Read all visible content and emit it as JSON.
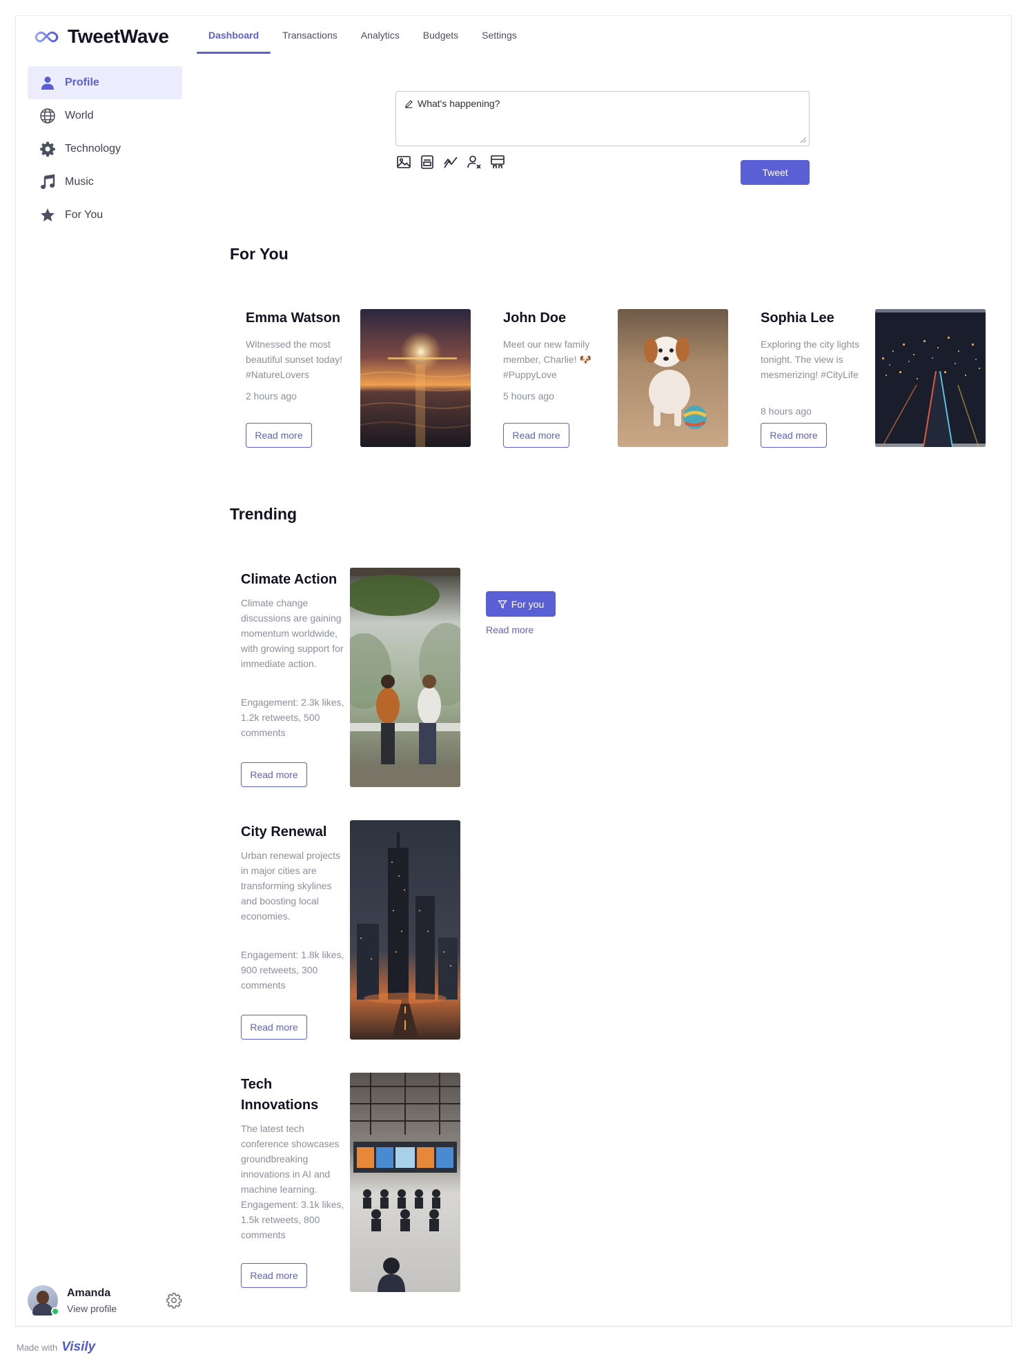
{
  "app": {
    "name": "TweetWave"
  },
  "nav": {
    "tabs": [
      {
        "label": "Dashboard",
        "active": true
      },
      {
        "label": "Transactions"
      },
      {
        "label": "Analytics"
      },
      {
        "label": "Budgets"
      },
      {
        "label": "Settings"
      }
    ]
  },
  "sidebar": {
    "items": [
      {
        "label": "Profile",
        "icon": "person-icon",
        "active": true
      },
      {
        "label": "World",
        "icon": "globe-icon"
      },
      {
        "label": "Technology",
        "icon": "gear-icon"
      },
      {
        "label": "Music",
        "icon": "music-note-icon"
      },
      {
        "label": "For You",
        "icon": "star-icon"
      }
    ]
  },
  "user": {
    "name": "Amanda",
    "link": "View profile"
  },
  "composer": {
    "placeholder": "What's happening?",
    "tools": [
      "image-icon",
      "gif-icon",
      "chart-icon",
      "person-remove-icon",
      "schedule-icon"
    ],
    "submit_label": "Tweet"
  },
  "for_you": {
    "title": "For You",
    "cards": [
      {
        "name": "Emma Watson",
        "text": "Witnessed the most beautiful sunset today! #NatureLovers",
        "time": "2 hours ago",
        "read_label": "Read more",
        "image": "sunset over ocean"
      },
      {
        "name": "John Doe",
        "text": "Meet our new family member, Charlie! 🐶 #PuppyLove",
        "time": "5 hours ago",
        "read_label": "Read more",
        "image": "puppy with ball"
      },
      {
        "name": "Sophia Lee",
        "text": "Exploring the city lights tonight. The view is mesmerizing! #CityLife",
        "time": "8 hours ago",
        "read_label": "Read more",
        "image": "city lights at night"
      }
    ]
  },
  "trending": {
    "title": "Trending",
    "items": [
      {
        "title": "Climate Action",
        "text": "Climate change discussions are gaining momentum worldwide, with growing support for immediate action.",
        "engagement": "Engagement: 2.3k likes, 1.2k retweets, 500 comments",
        "read_label": "Read more",
        "image": "people talking outdoors"
      },
      {
        "title": "City Renewal",
        "text": "Urban renewal projects in major cities are transforming skylines and boosting local economies.",
        "engagement": "Engagement: 1.8k likes, 900 retweets, 300 comments",
        "read_label": "Read more",
        "image": "city skyline at dusk"
      },
      {
        "title": "Tech Innovations",
        "text": "The latest tech conference showcases groundbreaking innovations in AI and machine learning.",
        "engagement": "Engagement: 3.1k likes, 1.5k retweets, 800 comments",
        "read_label": "Read more",
        "image": "tech conference hall"
      }
    ],
    "filter_label": "For you",
    "filter_link": "Read more"
  },
  "footer": {
    "made_with": "Made with",
    "brand": "Visily"
  },
  "colors": {
    "accent": "#5b5fd6",
    "muted_text": "#8a8f9c",
    "active_bg": "#ecedfc"
  }
}
